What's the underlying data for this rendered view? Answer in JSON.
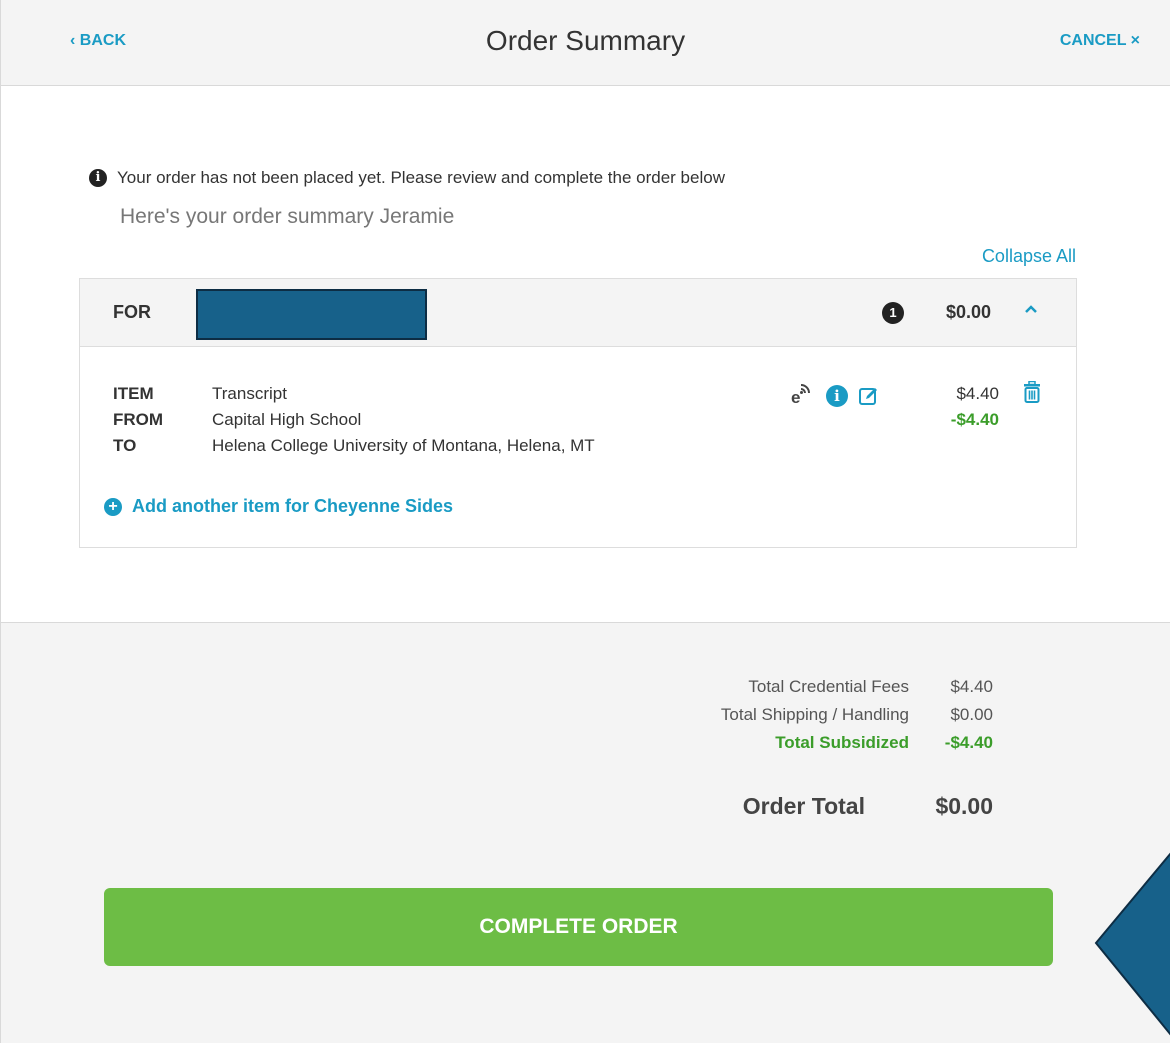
{
  "header": {
    "back_label": "‹ BACK",
    "title": "Order Summary",
    "cancel_label": "CANCEL ×"
  },
  "notice": {
    "icon": "info-circle-icon",
    "text": "Your order has not been placed yet. Please review and complete the order below"
  },
  "greeting": "Here's your order summary Jeramie",
  "collapse_all_label": "Collapse All",
  "recipient": {
    "for_label": "FOR",
    "item_count": "1",
    "total": "$0.00",
    "toggle_icon": "chevron-up-icon"
  },
  "item": {
    "rows": [
      {
        "key": "ITEM",
        "value": "Transcript"
      },
      {
        "key": "FROM",
        "value": "Capital High School"
      },
      {
        "key": "TO",
        "value": "Helena College University of Montana, Helena, MT"
      }
    ],
    "icons": [
      "e-delivery-icon",
      "info-icon",
      "edit-icon",
      "trash-icon"
    ],
    "price": "$4.40",
    "subsidy": "-$4.40"
  },
  "add_item_label": "Add another item for Cheyenne Sides",
  "totals": {
    "credential_fees_label": "Total Credential Fees",
    "credential_fees_value": "$4.40",
    "shipping_label": "Total Shipping / Handling",
    "shipping_value": "$0.00",
    "subsidized_label": "Total Subsidized",
    "subsidized_value": "-$4.40",
    "order_total_label": "Order Total",
    "order_total_value": "$0.00"
  },
  "complete_button_label": "COMPLETE ORDER",
  "colors": {
    "accent": "#1a9bc4",
    "success": "#6dbd45",
    "discount": "#3b9d2a",
    "redaction": "#17618a"
  }
}
